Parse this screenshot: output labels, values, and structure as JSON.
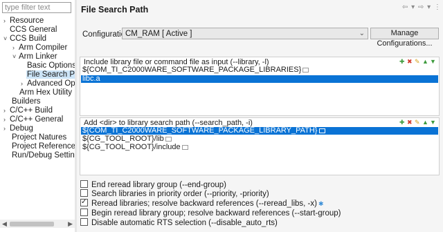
{
  "filter": {
    "placeholder": "type filter text"
  },
  "tree": [
    {
      "label": "Resource",
      "arrow": "›"
    },
    {
      "label": "CCS General",
      "arrow": ""
    },
    {
      "label": "CCS Build",
      "arrow": "˅"
    },
    {
      "label": "Arm Compiler",
      "arrow": "›"
    },
    {
      "label": "Arm Linker",
      "arrow": "˅"
    },
    {
      "label": "Basic Options",
      "arrow": ""
    },
    {
      "label": "File Search Path",
      "arrow": ""
    },
    {
      "label": "Advanced Option",
      "arrow": "›"
    },
    {
      "label": "Arm Hex Utility  [Disa",
      "arrow": ""
    },
    {
      "label": "Builders",
      "arrow": ""
    },
    {
      "label": "C/C++ Build",
      "arrow": "›"
    },
    {
      "label": "C/C++ General",
      "arrow": "›"
    },
    {
      "label": "Debug",
      "arrow": "›"
    },
    {
      "label": "Project Natures",
      "arrow": ""
    },
    {
      "label": "Project References",
      "arrow": ""
    },
    {
      "label": "Run/Debug Settings",
      "arrow": ""
    }
  ],
  "page": {
    "title": "File Search Path"
  },
  "nav": {
    "glyphs": "⇦ ▾ ⇨ ▾ ⋮"
  },
  "configuration": {
    "label": "Configuration:",
    "value": "CM_RAM  [ Active ]",
    "manage_button": "Manage Configurations..."
  },
  "include_group": {
    "title": "Include library file or command file as input (--library, -l)",
    "items": [
      "${COM_TI_C2000WARE_SOFTWARE_PACKAGE_LIBRARIES}",
      "libc.a"
    ]
  },
  "search_group": {
    "title": "Add <dir> to library search path (--search_path, -i)",
    "items": [
      "${COM_TI_C2000WARE_SOFTWARE_PACKAGE_LIBRARY_PATH}",
      "${CG_TOOL_ROOT}/lib",
      "${CG_TOOL_ROOT}/include"
    ]
  },
  "options": [
    {
      "label": "End reread library group (--end-group)",
      "checked": false
    },
    {
      "label": "Search libraries in priority order (--priority, -priority)",
      "checked": false
    },
    {
      "label": "Reread libraries; resolve backward references (--reread_libs, -x)",
      "checked": true
    },
    {
      "label": "Begin reread library group; resolve backward references (--start-group)",
      "checked": false
    },
    {
      "label": "Disable automatic RTS selection (--disable_auto_rts)",
      "checked": false
    }
  ],
  "colors": {
    "selection": "#0a73d5",
    "tree_selection": "#cce4f7",
    "add_icon": "#3c9a3c",
    "delete_icon": "#d23b2c",
    "edit_icon": "#d8a21b"
  }
}
